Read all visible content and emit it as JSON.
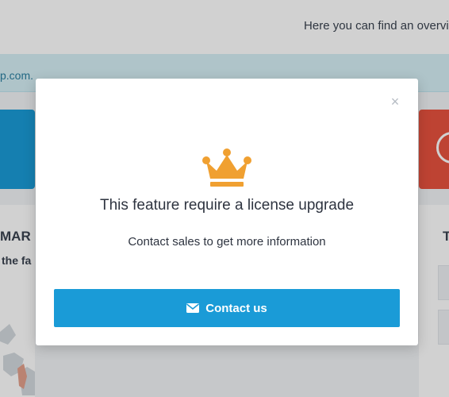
{
  "background": {
    "header_text": "Here you can find an overvie",
    "alert_text": "p.com.",
    "panel_left_title": "MAR",
    "panel_left_subtitle": "the fa",
    "panel_right_title": "T"
  },
  "modal": {
    "close_glyph": "×",
    "icon": "crown-icon",
    "title": "This feature require a license upgrade",
    "text": "Contact sales to get more information",
    "button_icon": "envelope-icon",
    "button_label": "Contact us"
  },
  "colors": {
    "accent": "#1a9bd7",
    "crown": "#f0a031",
    "danger": "#e8523f"
  }
}
